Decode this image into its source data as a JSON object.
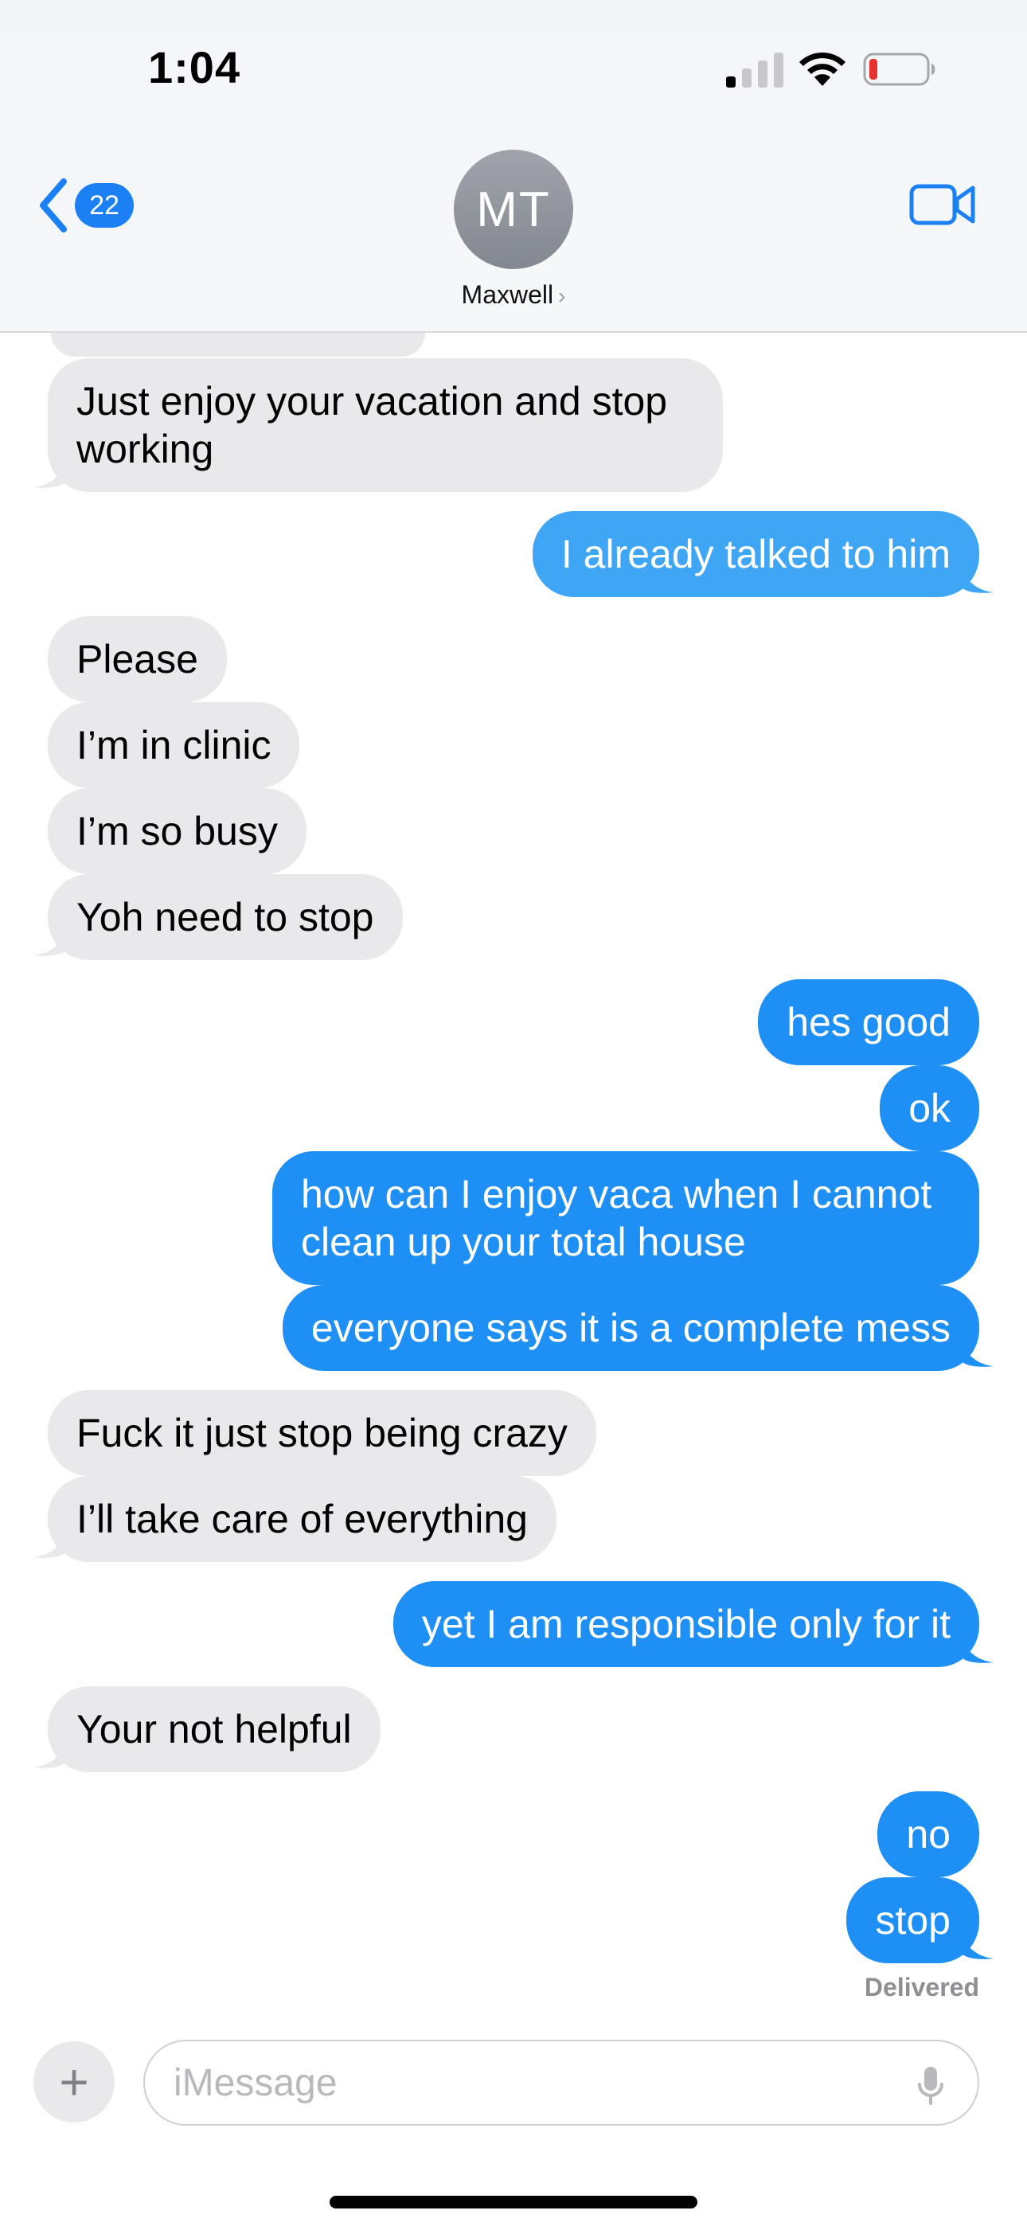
{
  "status_bar": {
    "time": "1:04",
    "signal_icon": "cellular-signal-icon",
    "wifi_icon": "wifi-icon",
    "battery_icon": "battery-low-icon",
    "battery_color": "#e5322d"
  },
  "header": {
    "back_count": "22",
    "avatar_initials": "MT",
    "contact_name": "Maxwell",
    "contact_chevron": "›",
    "video_icon": "video-call-icon",
    "accent": "#1a80f4"
  },
  "messages": [
    {
      "direction": "in",
      "text": "Just enjoy your vacation and stop working"
    },
    {
      "direction": "out",
      "text": "I already talked to him"
    },
    {
      "direction": "in",
      "text": "Please"
    },
    {
      "direction": "in",
      "text": "I’m in clinic"
    },
    {
      "direction": "in",
      "text": "I’m so busy"
    },
    {
      "direction": "in",
      "text": "Yoh need to stop"
    },
    {
      "direction": "out",
      "text": "hes good"
    },
    {
      "direction": "out",
      "text": "ok"
    },
    {
      "direction": "out",
      "text": "how can I enjoy vaca when I cannot clean up your total house"
    },
    {
      "direction": "out",
      "text": "everyone says it is a complete mess"
    },
    {
      "direction": "in",
      "text": "Fuck it just stop being crazy"
    },
    {
      "direction": "in",
      "text": "I’ll take care of everything"
    },
    {
      "direction": "out",
      "text": "yet I am responsible only for it"
    },
    {
      "direction": "in",
      "text": "Your not helpful"
    },
    {
      "direction": "out",
      "text": "no"
    },
    {
      "direction": "out",
      "text": "stop"
    }
  ],
  "delivery_status": "Delivered",
  "composer": {
    "placeholder": "iMessage",
    "plus_label": "+"
  },
  "colors": {
    "incoming_bubble": "#e9e9eb",
    "outgoing_bubble": "#1e8ff5",
    "outgoing_bubble_light": "#3fa6f6"
  }
}
